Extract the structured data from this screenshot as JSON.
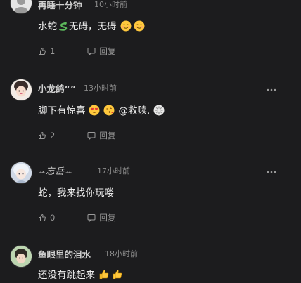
{
  "comments": [
    {
      "username": "再睡十分钟",
      "time": "10小时前",
      "text": "水蛇",
      "text2": "无碍，无碍",
      "likes": "1",
      "reply_label": "回复"
    },
    {
      "username": "小龙鸽“”",
      "time": "13小时前",
      "text": "脚下有惊喜",
      "mention": "@救赎.",
      "likes": "2",
      "reply_label": "回复"
    },
    {
      "username": "忘岳",
      "time": "17小时前",
      "text": "蛇，我来找你玩喽",
      "likes": "0",
      "reply_label": "回复"
    },
    {
      "username": "鱼眼里的泪水",
      "time": "18小时前",
      "text": "还没有跳起来"
    }
  ],
  "icons": {
    "like": "thumbs-up-icon",
    "reply": "reply-icon",
    "more": "more-icon"
  },
  "colors": {
    "background": "#1c1c1e",
    "text": "#f0f0f0",
    "muted": "#8a8a8a"
  }
}
